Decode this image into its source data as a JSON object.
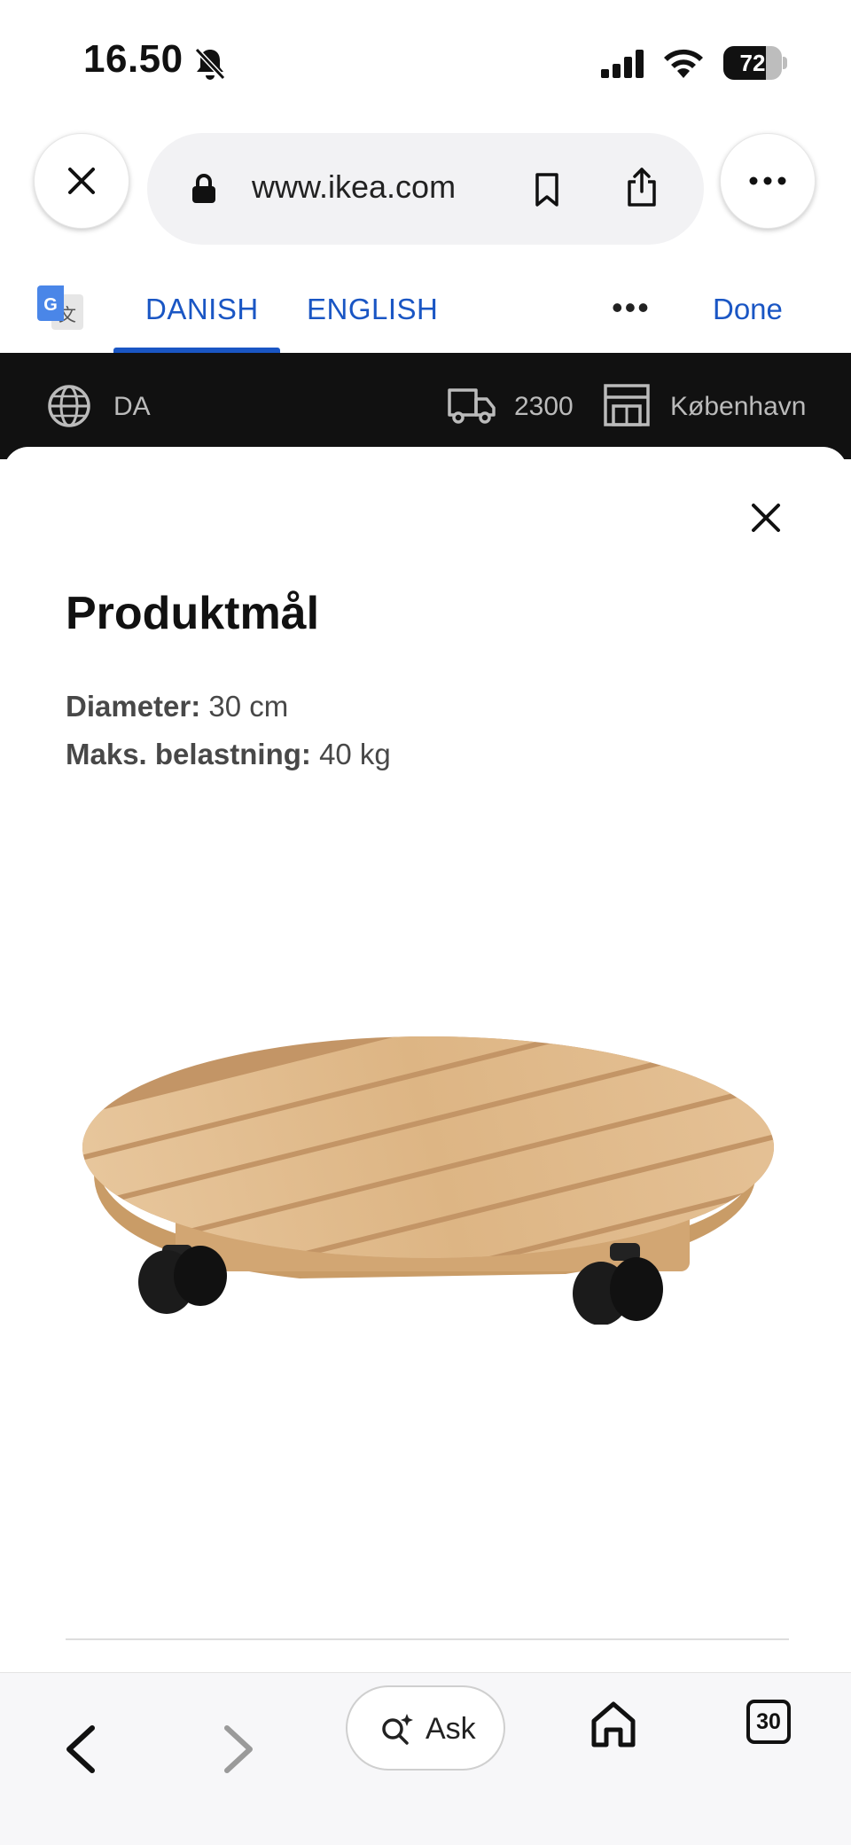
{
  "status_bar": {
    "time": "16.50",
    "battery_percent": "72",
    "battery_level": 0.72
  },
  "browser": {
    "url": "www.ikea.com",
    "icons": [
      "close-icon",
      "lock-icon",
      "bookmark-icon",
      "share-icon",
      "more-icon"
    ]
  },
  "translate_bar": {
    "source_language": "DANISH",
    "target_language": "ENGLISH",
    "done_label": "Done",
    "active_tab": "DANISH",
    "accent_color": "#1a56c4"
  },
  "ikea_header": {
    "language": "DA",
    "postcode": "2300",
    "store": "København"
  },
  "modal": {
    "title": "Produktmål",
    "dimensions": [
      {
        "label": "Diameter:",
        "value": "30 cm"
      },
      {
        "label": "Maks. belastning:",
        "value": "40 kg"
      }
    ]
  },
  "bottom_bar": {
    "ask_label": "Ask",
    "tab_count": "30"
  }
}
